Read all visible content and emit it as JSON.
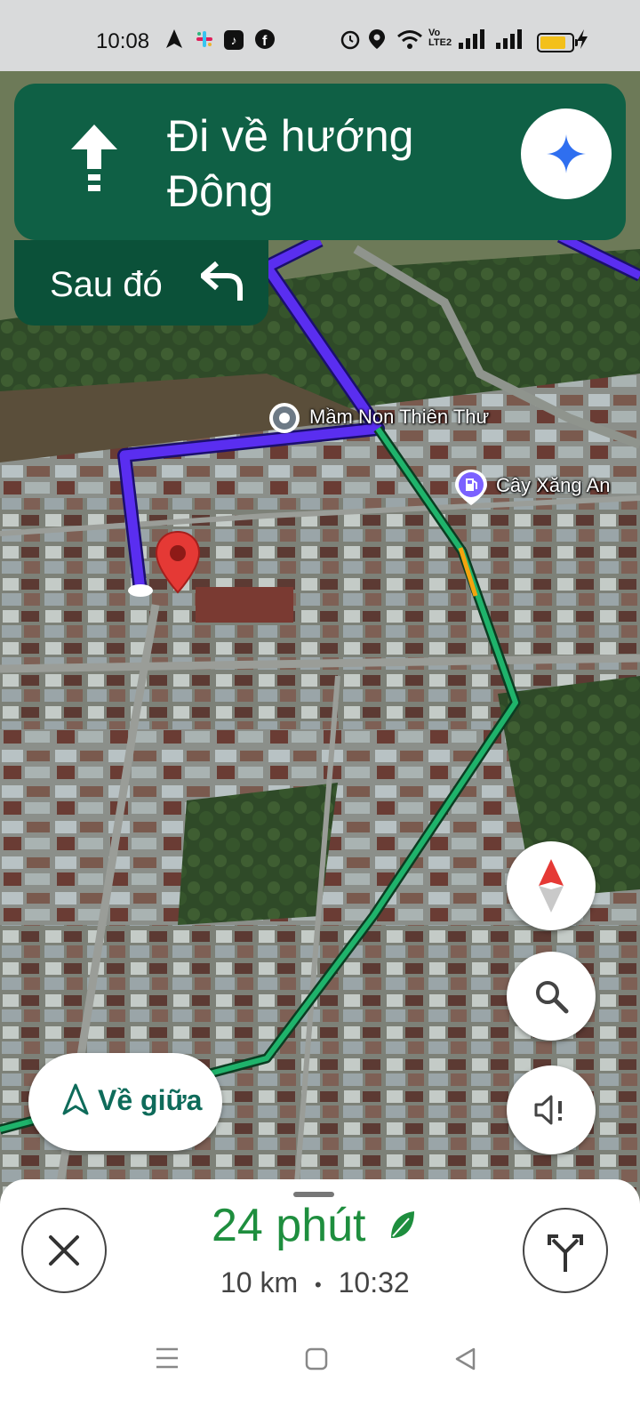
{
  "status_bar": {
    "time": "10:08",
    "network_label": "Vo LTE2",
    "icons": [
      "navigation-icon",
      "slack-icon",
      "tiktok-icon",
      "facebook-icon",
      "alarm-icon",
      "location-icon",
      "wifi-icon",
      "signal-icon",
      "signal-icon",
      "battery-icon",
      "charging-icon"
    ]
  },
  "navigation": {
    "instruction": "Đi về hướng Đông",
    "then_label": "Sau đó",
    "then_icon": "turn-left-icon",
    "assistant_icon": "gemini-icon"
  },
  "map": {
    "poi_school": "Mầm Non Thiên Thư",
    "poi_gas": "Cây Xăng An",
    "route_color": "#5a2ef0",
    "traffic_color": "#1fb36b",
    "destination_color": "#e53935"
  },
  "controls": {
    "recenter_label": "Về giữa",
    "compass": "compass-icon",
    "search": "search-icon",
    "sound": "volume-alert-icon"
  },
  "trip": {
    "duration": "24 phút",
    "distance": "10 km",
    "separator": "•",
    "arrival": "10:32",
    "eco_icon": "leaf-icon"
  },
  "system_nav": [
    "menu-icon",
    "home-icon",
    "back-icon"
  ]
}
